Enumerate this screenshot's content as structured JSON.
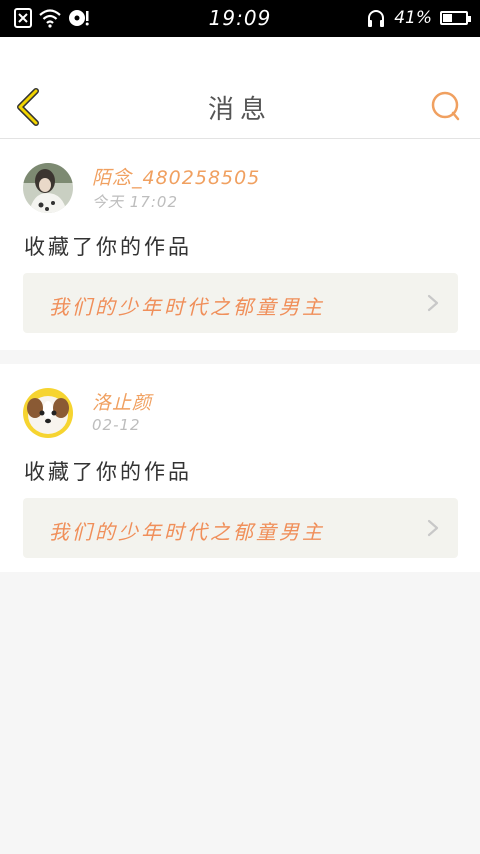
{
  "status_bar": {
    "time": "19:09",
    "battery_percent": "41%",
    "battery_level": 0.41,
    "icons": [
      "sim-off-icon",
      "wifi-icon",
      "media-icon",
      "headphones-icon",
      "battery-icon"
    ]
  },
  "header": {
    "title": "消息",
    "back_icon": "chevron-left-icon",
    "action_icon": "chat-bubble-icon"
  },
  "colors": {
    "accent_orange": "#f0a060",
    "back_yellow": "#f2d400",
    "card_bg": "#ffffff",
    "page_bg": "#f6f6f6",
    "work_bg": "#f3f3ee"
  },
  "messages": [
    {
      "username": "陌念_480258505",
      "time": "今天 17:02",
      "text": "收藏了你的作品",
      "work_title": "我们的少年时代之郁童男主"
    },
    {
      "username": "洛止颜",
      "time": "02-12",
      "text": "收藏了你的作品",
      "work_title": "我们的少年时代之郁童男主"
    }
  ]
}
